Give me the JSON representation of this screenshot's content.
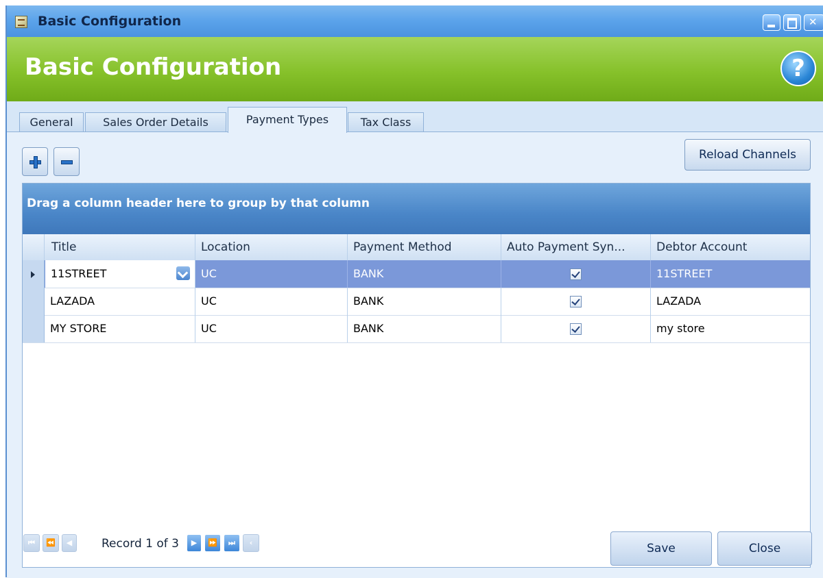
{
  "window": {
    "title": "Basic Configuration"
  },
  "header": {
    "title": "Basic Configuration",
    "help_icon": "?"
  },
  "tabs": [
    {
      "label": "General",
      "active": false
    },
    {
      "label": "Sales Order Details",
      "active": false
    },
    {
      "label": "Payment Types",
      "active": true
    },
    {
      "label": "Tax Class",
      "active": false
    }
  ],
  "toolbar": {
    "add_icon": "plus-icon",
    "remove_icon": "minus-icon",
    "reload_label": "Reload Channels"
  },
  "grid": {
    "group_panel_text": "Drag a column header here to group by that column",
    "columns": [
      "Title",
      "Location",
      "Payment Method",
      "Auto Payment Syn...",
      "Debtor Account"
    ],
    "rows": [
      {
        "title": "11STREET",
        "location": "UC",
        "payment_method": "BANK",
        "auto_payment_sync": true,
        "debtor_account": "11STREET",
        "selected": true
      },
      {
        "title": "LAZADA",
        "location": "UC",
        "payment_method": "BANK",
        "auto_payment_sync": true,
        "debtor_account": "LAZADA",
        "selected": false
      },
      {
        "title": "MY STORE",
        "location": "UC",
        "payment_method": "BANK",
        "auto_payment_sync": true,
        "debtor_account": "my store",
        "selected": false
      }
    ]
  },
  "navigator": {
    "record_text": "Record 1 of 3"
  },
  "footer": {
    "save_label": "Save",
    "close_label": "Close"
  },
  "colors": {
    "titlebar": "#5aa2ea",
    "header_green": "#86c12a",
    "selected_row": "#7b98d9",
    "group_panel": "#4a86c8"
  }
}
